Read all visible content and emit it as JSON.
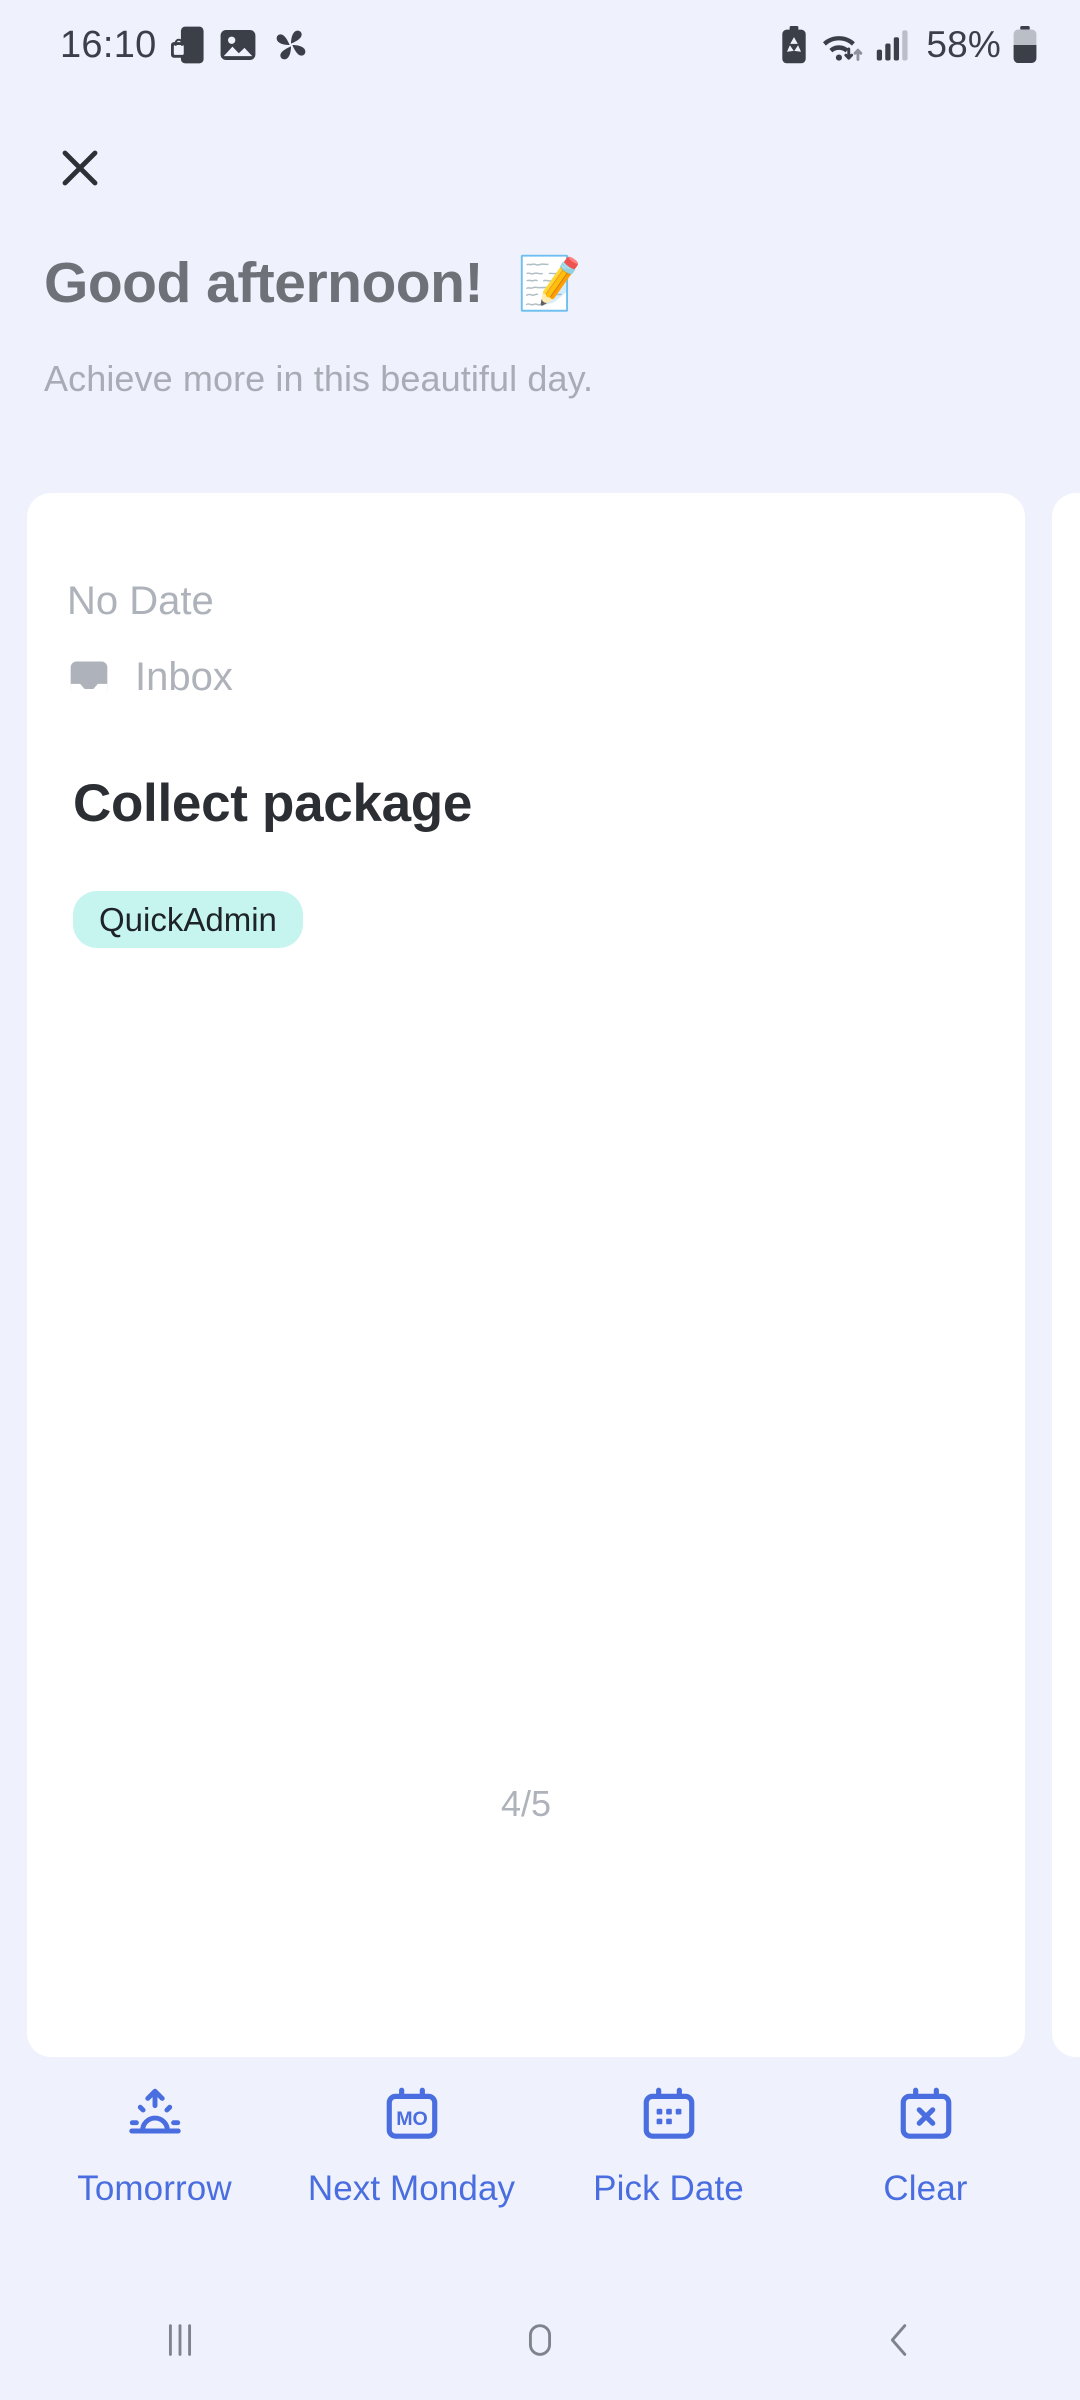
{
  "status_bar": {
    "time": "16:10",
    "battery_percent": "58%",
    "left_icons": [
      "phone-lock-icon",
      "image-icon",
      "pinwheel-icon"
    ],
    "right_icons": [
      "battery-saver-icon",
      "wifi-icon",
      "signal-bars-icon",
      "battery-icon"
    ]
  },
  "header": {
    "close_label": "close-icon",
    "greeting": "Good afternoon!",
    "greeting_emoji": "📝",
    "subtitle": "Achieve more in this beautiful day."
  },
  "card": {
    "date_label": "No Date",
    "project_icon": "inbox-icon",
    "project": "Inbox",
    "task_title": "Collect package",
    "tags": [
      "QuickAdmin"
    ],
    "counter": "4/5"
  },
  "actions": [
    {
      "label": "Tomorrow",
      "icon": "sunrise-icon"
    },
    {
      "label": "Next Monday",
      "icon": "calendar-monday-icon"
    },
    {
      "label": "Pick Date",
      "icon": "calendar-dots-icon"
    },
    {
      "label": "Clear",
      "icon": "calendar-x-icon"
    }
  ],
  "nav_bar": {
    "recents": "recents-icon",
    "home": "home-icon",
    "back": "back-icon"
  },
  "colors": {
    "background": "#eff2fc",
    "card": "#ffffff",
    "accent_blue": "#4a6ee0",
    "tag_bg": "#c6f4ef",
    "title_gray": "#6e7278",
    "muted_gray": "#aeb2ba"
  }
}
